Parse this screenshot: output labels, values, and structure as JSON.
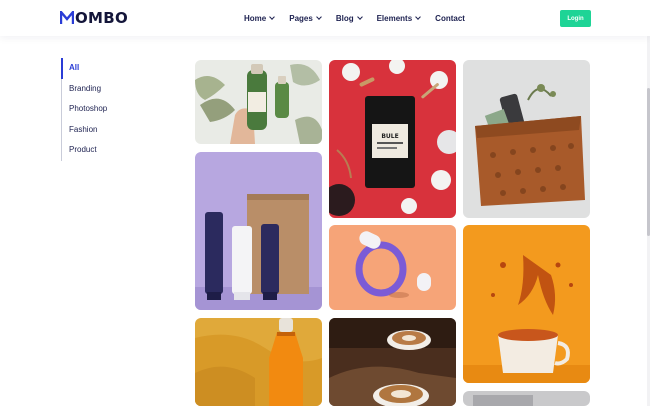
{
  "brand": {
    "logo_text": "OMBO",
    "logo_mark": "M"
  },
  "nav": {
    "items": [
      {
        "label": "Home",
        "has_dropdown": true
      },
      {
        "label": "Pages",
        "has_dropdown": true
      },
      {
        "label": "Blog",
        "has_dropdown": true
      },
      {
        "label": "Elements",
        "has_dropdown": true
      },
      {
        "label": "Contact",
        "has_dropdown": false
      }
    ],
    "login_label": "Login"
  },
  "filters": {
    "items": [
      "All",
      "Branding",
      "Photoshop",
      "Fashion",
      "Product"
    ],
    "active": "All"
  },
  "colors": {
    "accent": "#2a3cd6",
    "login_bg": "#1ed496",
    "text_dark": "#1d2150"
  },
  "gallery": {
    "items": [
      {
        "name": "green-bottle-product"
      },
      {
        "name": "coffee-bag-red-product"
      },
      {
        "name": "pouch-phone-product"
      },
      {
        "name": "cosmetics-purple-product"
      },
      {
        "name": "purple-ring-peach-product"
      },
      {
        "name": "orange-splash-cup-product"
      },
      {
        "name": "yellow-bottle-fashion"
      },
      {
        "name": "latte-art-coffee"
      }
    ],
    "coffee_label": "BULE"
  }
}
